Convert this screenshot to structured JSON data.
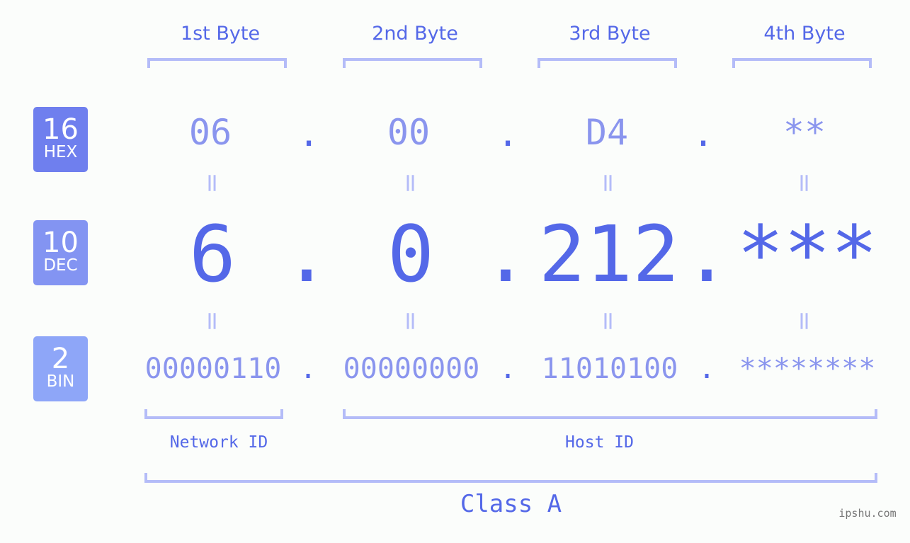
{
  "bytes": {
    "labels": [
      "1st Byte",
      "2nd Byte",
      "3rd Byte",
      "4th Byte"
    ]
  },
  "badges": {
    "hex": {
      "num": "16",
      "label": "HEX",
      "color": "#6f7fee"
    },
    "dec": {
      "num": "10",
      "label": "DEC",
      "color": "#8394f2"
    },
    "bin": {
      "num": "2",
      "label": "BIN",
      "color": "#8ea6f8"
    }
  },
  "hex_values": [
    "06",
    "00",
    "D4",
    "**"
  ],
  "dec_values": [
    "6",
    "0",
    "212",
    "***"
  ],
  "bin_values": [
    "00000110",
    "00000000",
    "11010100",
    "********"
  ],
  "separator": ".",
  "equals_sign": "=",
  "network_label": "Network ID",
  "host_label": "Host ID",
  "class_label": "Class A",
  "watermark": "ipshu.com",
  "colors": {
    "primary": "#5468e8",
    "light": "#8a95ee",
    "bracket": "#b4bcf8"
  }
}
